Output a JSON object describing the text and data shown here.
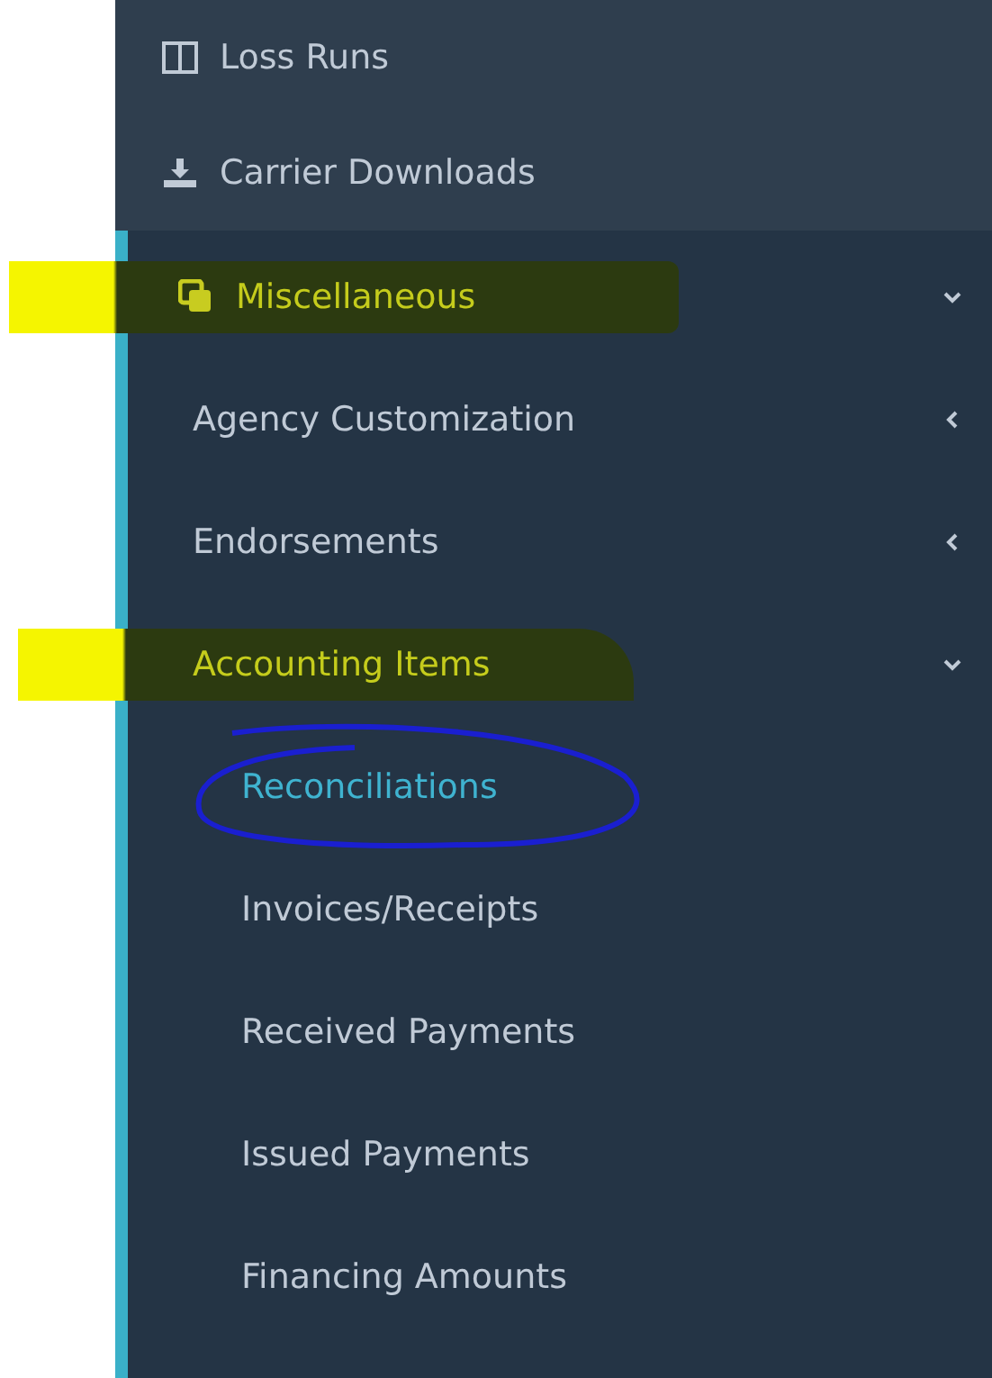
{
  "sidebar": {
    "top_items": [
      {
        "label": "Loss Runs"
      },
      {
        "label": "Carrier Downloads"
      }
    ],
    "section": {
      "label": "Miscellaneous",
      "expanded": true,
      "highlighted": true,
      "children": [
        {
          "label": "Agency Customization",
          "expanded": false,
          "highlighted": false
        },
        {
          "label": "Endorsements",
          "expanded": false,
          "highlighted": false
        },
        {
          "label": "Accounting Items",
          "expanded": true,
          "highlighted": true,
          "children": [
            {
              "label": "Reconciliations",
              "selected": true,
              "circled": true
            },
            {
              "label": "Invoices/Receipts",
              "selected": false,
              "circled": false
            },
            {
              "label": "Received Payments",
              "selected": false,
              "circled": false
            },
            {
              "label": "Issued Payments",
              "selected": false,
              "circled": false
            },
            {
              "label": "Financing Amounts",
              "selected": false,
              "circled": false
            }
          ]
        }
      ]
    }
  }
}
